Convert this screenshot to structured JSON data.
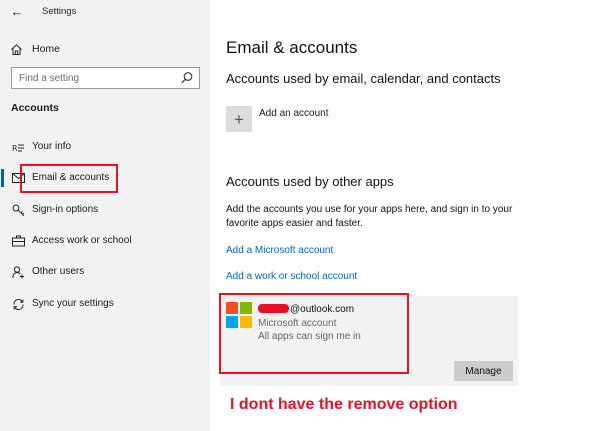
{
  "window": {
    "title": "Settings"
  },
  "nav": {
    "back_glyph": "←",
    "home_label": "Home",
    "search_placeholder": "Find a setting",
    "section_title": "Accounts",
    "items": [
      {
        "label": "Your info",
        "icon": "contact-card-icon"
      },
      {
        "label": "Email & accounts",
        "icon": "mail-icon",
        "selected": true
      },
      {
        "label": "Sign-in options",
        "icon": "key-icon"
      },
      {
        "label": "Access work or school",
        "icon": "briefcase-icon"
      },
      {
        "label": "Other users",
        "icon": "person-add-icon"
      },
      {
        "label": "Sync your settings",
        "icon": "sync-icon"
      }
    ]
  },
  "main": {
    "title": "Email & accounts",
    "email_section": {
      "heading": "Accounts used by email, calendar, and contacts",
      "add_label": "Add an account",
      "add_glyph": "+"
    },
    "other_apps_section": {
      "heading": "Accounts used by other apps",
      "description": "Add the accounts you use for your apps here, and sign in to your favorite apps easier and faster.",
      "add_ms_link": "Add a Microsoft account",
      "add_work_link": "Add a work or school account"
    },
    "account": {
      "email_suffix": "@outlook.com",
      "type": "Microsoft account",
      "status": "All apps can sign me in",
      "manage_label": "Manage"
    }
  },
  "annotation": {
    "text": "I dont have the remove option"
  },
  "colors": {
    "accent": "#0063b1",
    "link": "#0067b8",
    "highlight": "#e81123",
    "ms_red": "#f25022",
    "ms_green": "#7fba00",
    "ms_blue": "#00a4ef",
    "ms_yellow": "#ffb900"
  }
}
